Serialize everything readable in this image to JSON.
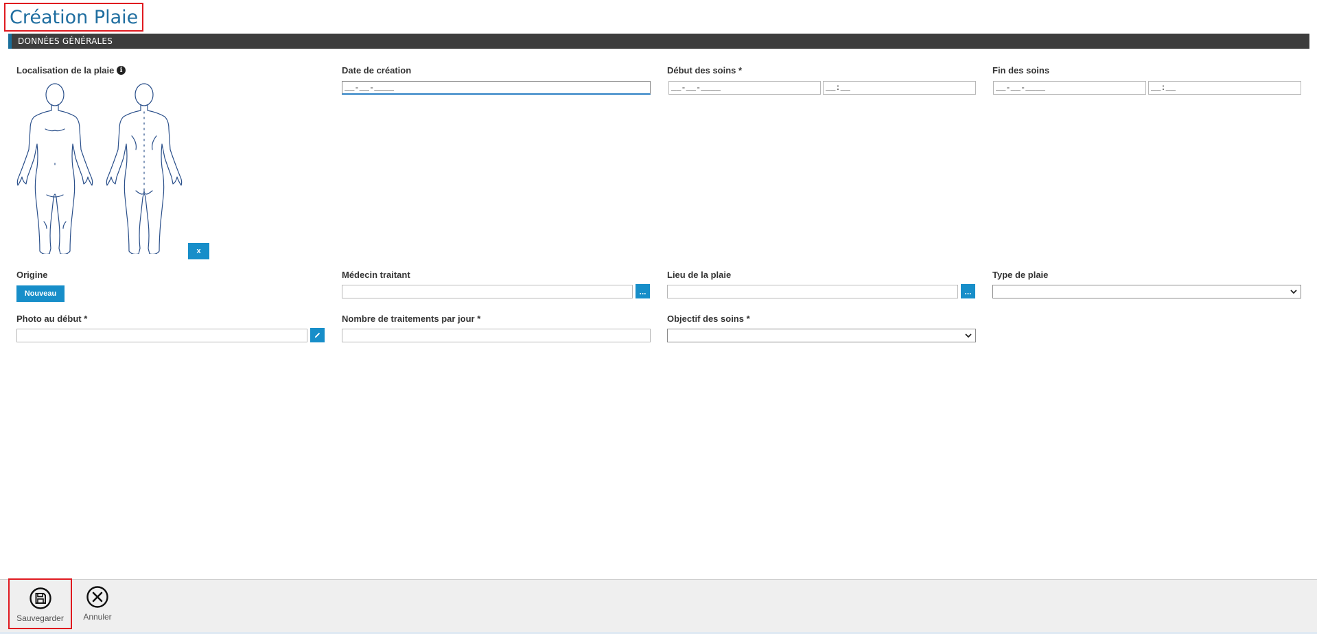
{
  "page": {
    "title": "Création Plaie"
  },
  "section": {
    "title": "DONNÉES GÉNÉRALES"
  },
  "fields": {
    "localisation": {
      "label": "Localisation de la plaie",
      "clear_label": "x"
    },
    "date_creation": {
      "label": "Date de création",
      "value": "__-__-____"
    },
    "debut_soins": {
      "label": "Début des soins *",
      "date_value": "__-__-____",
      "time_value": "__:__"
    },
    "fin_soins": {
      "label": "Fin des soins",
      "date_value": "__-__-____",
      "time_value": "__:__"
    },
    "origine": {
      "label": "Origine",
      "button_label": "Nouveau"
    },
    "medecin": {
      "label": "Médecin traitant",
      "value": "",
      "picker_label": "..."
    },
    "lieu": {
      "label": "Lieu de la plaie",
      "value": "",
      "picker_label": "..."
    },
    "type_plaie": {
      "label": "Type de plaie",
      "value": ""
    },
    "photo_debut": {
      "label": "Photo au début *",
      "value": ""
    },
    "nb_traitements": {
      "label": "Nombre de traitements par jour *",
      "value": ""
    },
    "objectif": {
      "label": "Objectif des soins *",
      "value": ""
    }
  },
  "toolbar": {
    "save_label": "Sauvegarder",
    "cancel_label": "Annuler"
  },
  "colors": {
    "accent": "#178ec9",
    "title": "#1f6ea0",
    "header_bg": "#3d3d3d",
    "highlight": "#e0191f",
    "body_outline": "#2a4f8a"
  },
  "icons": {
    "info": "info-icon",
    "edit": "pencil-icon",
    "save": "floppy-disk-icon",
    "cancel": "close-circle-icon"
  }
}
